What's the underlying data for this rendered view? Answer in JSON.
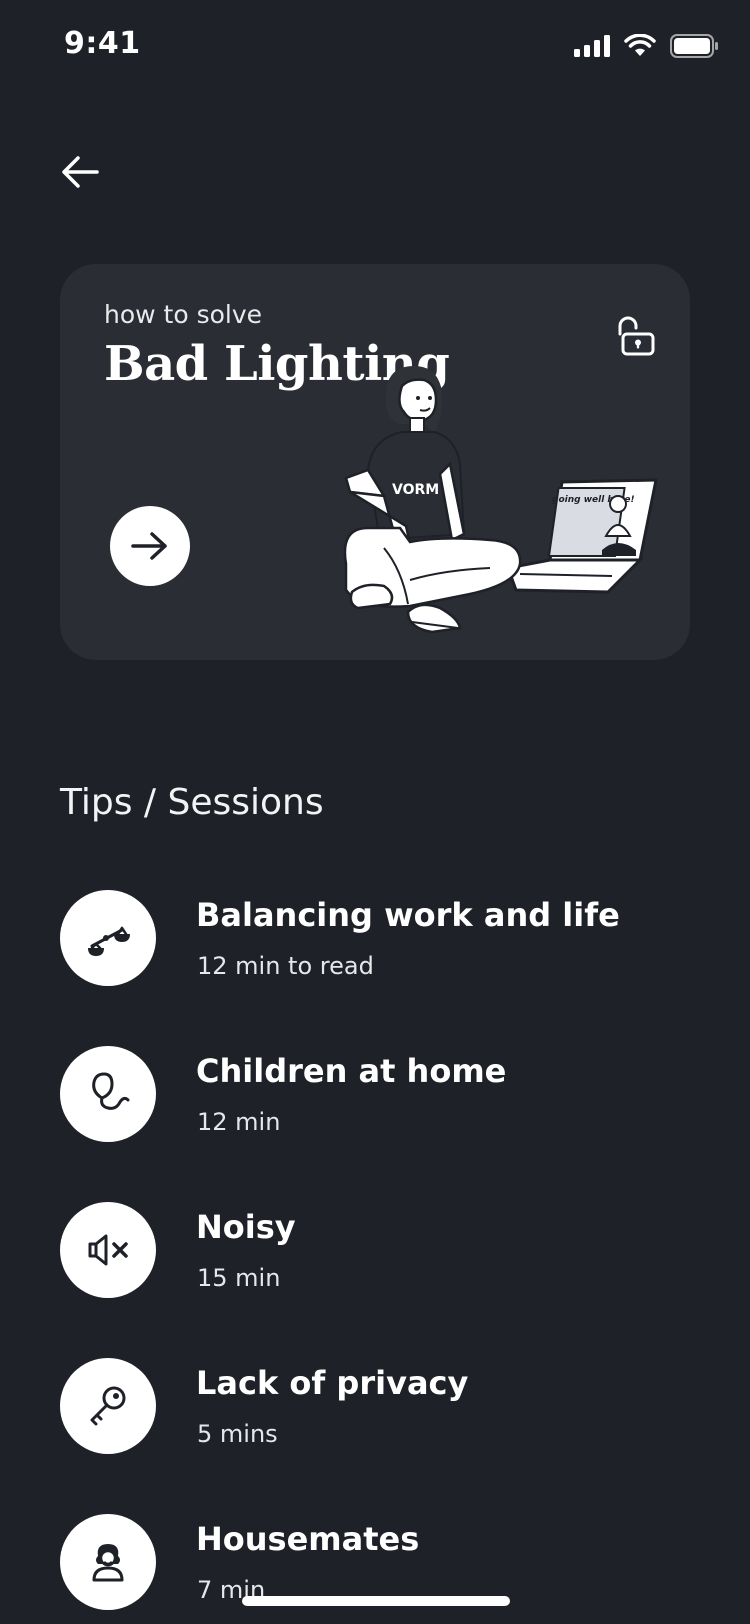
{
  "status_bar": {
    "time": "9:41",
    "icons": [
      "cellular-signal-icon",
      "wifi-icon",
      "battery-icon"
    ]
  },
  "navigation": {
    "back_icon": "arrow-left-icon"
  },
  "hero": {
    "subtitle": "how to solve",
    "title": "Bad Lighting",
    "lock_icon": "unlocked-padlock-icon",
    "action_icon": "arrow-right-icon",
    "illustration": "person-sitting-with-laptop",
    "illustration_shirt_text": "VORM",
    "illustration_screen_text": "going well here!"
  },
  "tips": {
    "section_title": "Tips / Sessions",
    "items": [
      {
        "title": "Balancing work and life",
        "meta": "12 min to read",
        "icon": "balance-scale-icon"
      },
      {
        "title": "Children at home",
        "meta": "12 min",
        "icon": "balloon-icon"
      },
      {
        "title": "Noisy",
        "meta": "15 min",
        "icon": "speaker-muted-icon"
      },
      {
        "title": "Lack of privacy",
        "meta": "5 mins",
        "icon": "key-icon"
      },
      {
        "title": "Housemates",
        "meta": "7 min",
        "icon": "person-icon"
      }
    ]
  },
  "colors": {
    "background": "#1e2127",
    "card": "#2a2d33",
    "text": "#ffffff",
    "icon_bg": "#ffffff",
    "icon_fg": "#1e2127"
  }
}
